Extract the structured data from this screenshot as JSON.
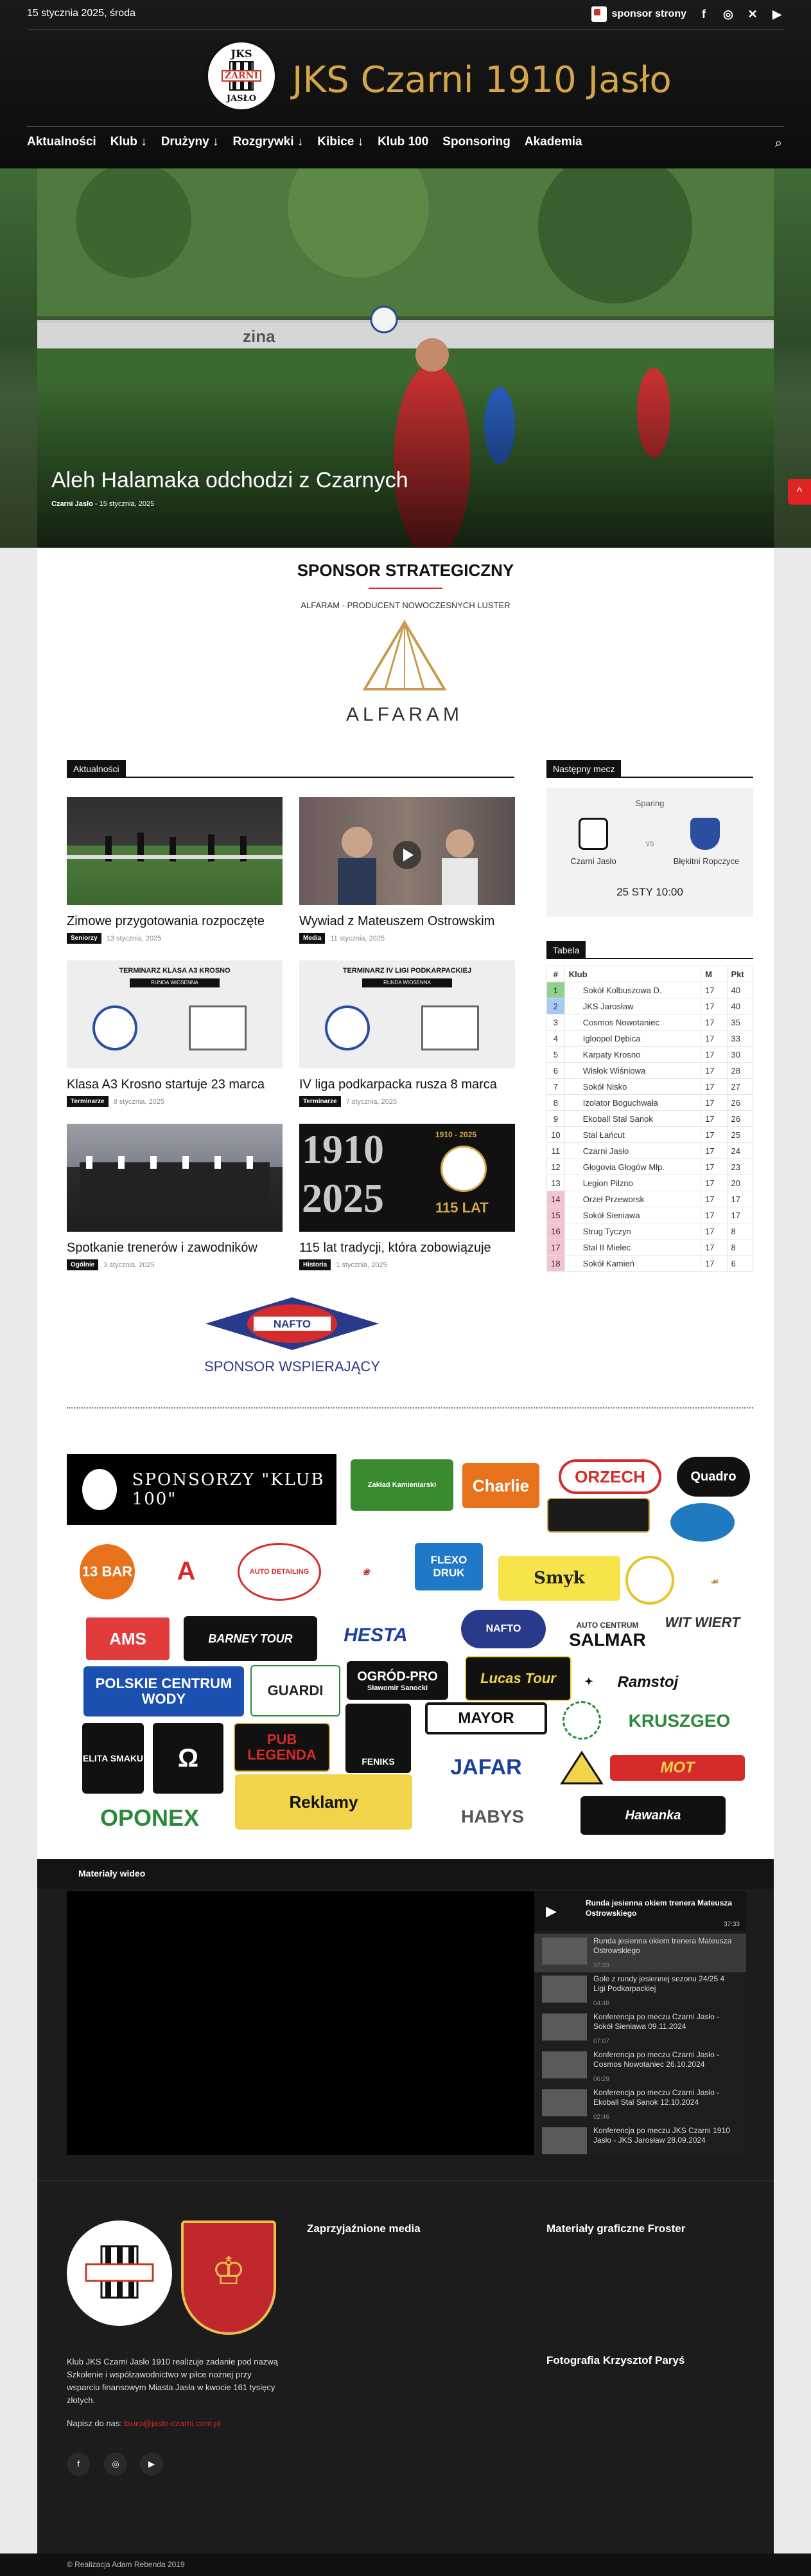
{
  "header": {
    "date": "15 stycznia 2025, środa",
    "sponsor_link": "sponsor strony",
    "site_title": "JKS Czarni 1910 Jasło",
    "logo_text_top": "JKS",
    "logo_text_mid": "ZARNI",
    "logo_text_bottom": "JASŁO",
    "nav": [
      "Aktualności",
      "Klub ↓",
      "Drużyny ↓",
      "Rozgrywki ↓",
      "Kibice ↓",
      "Klub 100",
      "Sponsoring",
      "Akademia"
    ]
  },
  "hero": {
    "title": "Aleh Halamaka odchodzi z Czarnych",
    "author": "Czarni Jasło",
    "date": "15 stycznia, 2025"
  },
  "strategic_sponsor": {
    "heading": "SPONSOR STRATEGICZNY",
    "subheading": "ALFARAM - PRODUCENT NOWOCZESNYCH LUSTER",
    "logo_text": "ALFARAM"
  },
  "news": {
    "section_label": "Aktualności",
    "items": [
      {
        "title": "Zimowe przygotowania rozpoczęte",
        "tag": "Seniorzy",
        "date": "13 stycznia, 2025"
      },
      {
        "title": "Wywiad z Mateuszem Ostrowskim",
        "tag": "Media",
        "date": "11 stycznia, 2025"
      },
      {
        "title": "Klasa A3 Krosno startuje 23 marca",
        "tag": "Terminarze",
        "date": "8 stycznia, 2025"
      },
      {
        "title": "IV liga podkarpacka rusza 8 marca",
        "tag": "Terminarze",
        "date": "7 stycznia, 2025"
      },
      {
        "title": "Spotkanie trenerów i zawodników",
        "tag": "Ogólnie",
        "date": "3 stycznia, 2025"
      },
      {
        "title": "115 lat tradycji, która zobowiązuje",
        "tag": "Historia",
        "date": "1 stycznia, 2025"
      }
    ],
    "poster_a": {
      "line1": "TERMINARZ KLASA A3 KROSNO",
      "line2": "RUNDA WIOSENNA"
    },
    "poster_b": {
      "line1": "TERMINARZ IV LIGI PODKARPACKIEJ",
      "line2": "RUNDA WIOSENNA"
    },
    "anniv": {
      "years": "1910 - 2025",
      "big1": "1910",
      "big2": "2025",
      "label": "115 LAT"
    }
  },
  "next_match": {
    "label": "Następny mecz",
    "type": "Sparing",
    "home": "Czarni Jasło",
    "vs": "vs",
    "away": "Błękitni Ropczyce",
    "date": "25 STY",
    "time": "10:00"
  },
  "table": {
    "label": "Tabela",
    "headers": [
      "#",
      "Klub",
      "M",
      "Pkt"
    ],
    "rows": [
      {
        "pos": "1",
        "club": "Sokół Kolbuszowa D.",
        "m": "17",
        "pts": "40",
        "zone": "#8fd18f"
      },
      {
        "pos": "2",
        "club": "JKS Jarosław",
        "m": "17",
        "pts": "40",
        "zone": "#a9c9f2"
      },
      {
        "pos": "3",
        "club": "Cosmos Nowotaniec",
        "m": "17",
        "pts": "35",
        "zone": ""
      },
      {
        "pos": "4",
        "club": "Igloopol Dębica",
        "m": "17",
        "pts": "33",
        "zone": ""
      },
      {
        "pos": "5",
        "club": "Karpaty Krosno",
        "m": "17",
        "pts": "30",
        "zone": ""
      },
      {
        "pos": "6",
        "club": "Wisłok Wiśniowa",
        "m": "17",
        "pts": "28",
        "zone": ""
      },
      {
        "pos": "7",
        "club": "Sokół Nisko",
        "m": "17",
        "pts": "27",
        "zone": ""
      },
      {
        "pos": "8",
        "club": "Izolator Boguchwała",
        "m": "17",
        "pts": "26",
        "zone": ""
      },
      {
        "pos": "9",
        "club": "Ekoball Stal Sanok",
        "m": "17",
        "pts": "26",
        "zone": ""
      },
      {
        "pos": "10",
        "club": "Stal Łańcut",
        "m": "17",
        "pts": "25",
        "zone": ""
      },
      {
        "pos": "11",
        "club": "Czarni Jasło",
        "m": "17",
        "pts": "24",
        "zone": ""
      },
      {
        "pos": "12",
        "club": "Głogovia Głogów Młp.",
        "m": "17",
        "pts": "23",
        "zone": ""
      },
      {
        "pos": "13",
        "club": "Legion Pilzno",
        "m": "17",
        "pts": "20",
        "zone": ""
      },
      {
        "pos": "14",
        "club": "Orzeł Przeworsk",
        "m": "17",
        "pts": "17",
        "zone": "#f2c4cf"
      },
      {
        "pos": "15",
        "club": "Sokół Sieniawa",
        "m": "17",
        "pts": "17",
        "zone": "#f2c4cf"
      },
      {
        "pos": "16",
        "club": "Strug Tyczyn",
        "m": "17",
        "pts": "8",
        "zone": "#f2c4cf"
      },
      {
        "pos": "17",
        "club": "Stal II Mielec",
        "m": "17",
        "pts": "8",
        "zone": "#f2c4cf"
      },
      {
        "pos": "18",
        "club": "Sokół Kamień",
        "m": "17",
        "pts": "6",
        "zone": "#f2c4cf"
      }
    ]
  },
  "supporting_sponsor": {
    "logo_text": "NAFTO",
    "caption": "SPONSOR WSPIERAJĄCY"
  },
  "klub100": {
    "banner": "SPONSORZY \"KLUB 100\"",
    "logos": [
      "Charlie",
      "ORZECH",
      "Quadro",
      "13 BAR",
      "AUTO DETAILING",
      "FLEXO DRUK",
      "Smyk",
      "AMS",
      "BARNEY TOUR",
      "HESTA",
      "NAFTO",
      "SALMAR",
      "POLSKIE CENTRUM WODY",
      "GUARDI",
      "OGRÓD-PRO",
      "Lucas Tour",
      "Ramstoj",
      "ELITA SMAKU",
      "PUB LEGENDA",
      "FENIKS",
      "MAYOR",
      "KRUSZGEO",
      "Reklamy",
      "JAFAR",
      "MOT",
      "OPONEX",
      "HABYS",
      "Hawanka"
    ],
    "sub": {
      "salmar": "AUTO CENTRUM",
      "wit": "WIT WIERT",
      "ogrod": "Sławomir Sanocki",
      "charlie": "Zakład Kamieniarski"
    }
  },
  "video": {
    "section_label": "Materiały wideo",
    "featured_title": "Runda jesienna okiem trenera Mateusza Ostrowskiego",
    "featured_duration": "37:33",
    "items": [
      {
        "title": "Runda jesienna okiem trenera Mateusza Ostrowskiego",
        "duration": "37:33"
      },
      {
        "title": "Gole z rundy jesiennej sezonu 24/25 4 Ligi Podkarpackiej",
        "duration": "04:48"
      },
      {
        "title": "Konferencja po meczu Czarni Jasło - Sokół Sieniawa 09.11.2024",
        "duration": "07:07"
      },
      {
        "title": "Konferencja po meczu Czarni Jasło - Cosmos Nowotaniec 26.10.2024",
        "duration": "06:29"
      },
      {
        "title": "Konferencja po meczu Czarni Jasło - Ekoball Stal Sanok 12.10.2024",
        "duration": "02:46"
      },
      {
        "title": "Konferencja po meczu JKS Czarni 1910 Jasło - JKS Jarosław 28.09.2024",
        "duration": ""
      }
    ]
  },
  "footer": {
    "about": "Klub JKS Czarni Jasło 1910 realizuje zadanie pod nazwą Szkolenie i współzawodnictwo w piłce nożnej przy wsparciu finansowym Miasta Jasła w kwocie 161 tysięcy złotych.",
    "write_label": "Napisz do nas:",
    "email": "biuro@jaslo-czarni.com.pl",
    "media_heading": "Zaprzyjaźnione media",
    "graphics_heading": "Materiały graficzne Froster",
    "photo_heading": "Fotografia Krzysztof Paryś",
    "copyright": "© Realizacja Adam Rebenda 2019"
  }
}
